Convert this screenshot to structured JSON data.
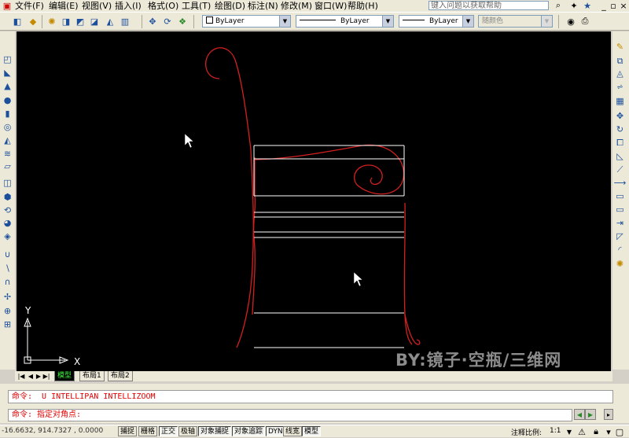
{
  "menu": {
    "items": [
      "文件(F)",
      "编辑(E)",
      "视图(V)",
      "插入(I)",
      "格式(O)",
      "工具(T)",
      "绘图(D)",
      "标注(N)",
      "修改(M)",
      "窗口(W)",
      "帮助(H)"
    ],
    "help_placeholder": "键入问题以获取帮助"
  },
  "toolbar": {
    "layer_combo": "ByLayer",
    "linetype_combo": "ByLayer",
    "lineweight_combo": "ByLayer",
    "color_combo": "随颜色"
  },
  "canvas": {
    "background": "#000000",
    "drawing_color": "#d42020",
    "line_color": "#ffffff",
    "ucs": {
      "x_label": "X",
      "y_label": "Y"
    }
  },
  "tabs": [
    "模型",
    "布局1",
    "布局2"
  ],
  "command": {
    "history": "命令:  U INTELLIPAN INTELLIZOOM",
    "prompt": "命令: 指定对角点:"
  },
  "status": {
    "coords": "-16.6632,  914.7327 , 0.0000",
    "buttons": [
      "捕捉",
      "栅格",
      "正交",
      "极轴",
      "对象捕捉",
      "对象追踪",
      "DYN",
      "线宽",
      "模型"
    ],
    "scale_label": "注释比例:",
    "scale_value": "1:1"
  },
  "watermark": "BY:镜子·空瓶/三维网"
}
